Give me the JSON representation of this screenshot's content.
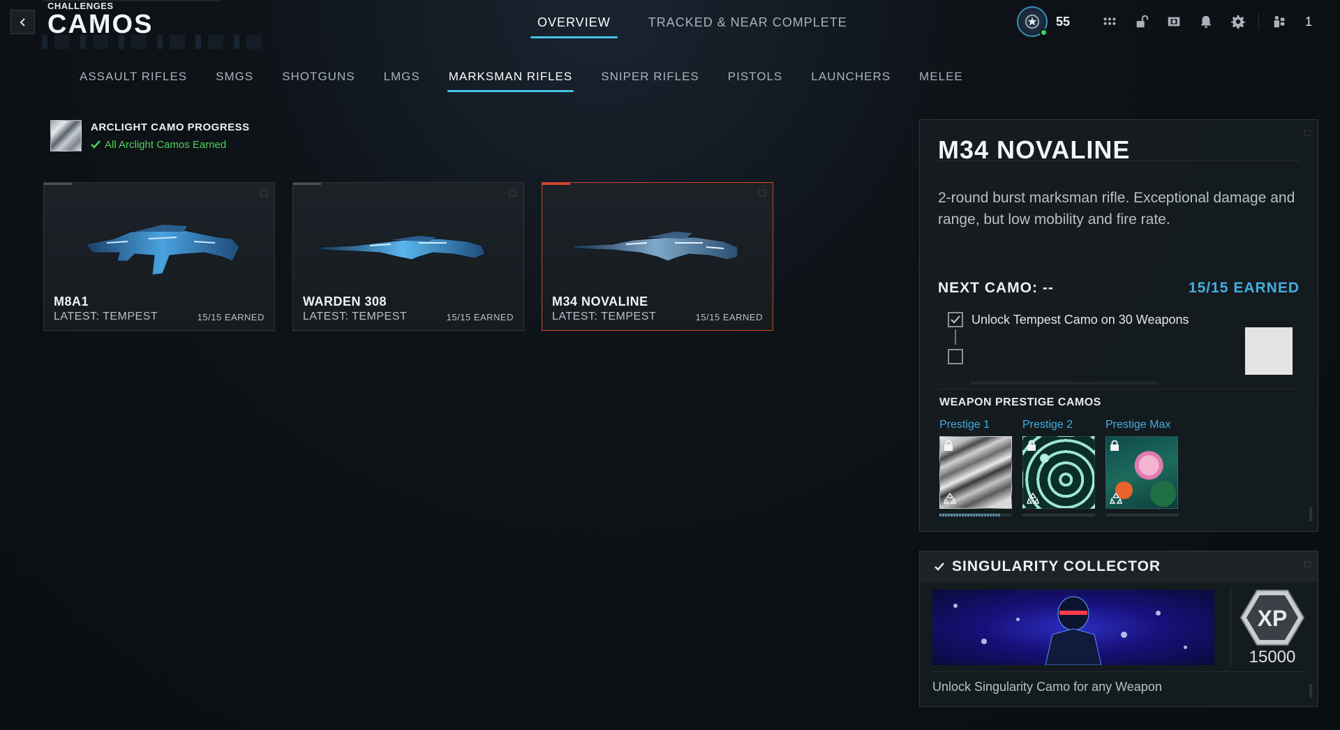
{
  "header": {
    "breadcrumb": "CHALLENGES",
    "title": "CAMOS",
    "tabs": [
      {
        "label": "OVERVIEW",
        "active": true
      },
      {
        "label": "TRACKED & NEAR COMPLETE",
        "active": false
      }
    ],
    "player_level": "55",
    "party_count": "1",
    "icons": [
      "grid-menu-icon",
      "lock-open-icon",
      "camera-icon",
      "bell-icon",
      "gear-icon",
      "party-icon"
    ]
  },
  "categories": [
    {
      "label": "ASSAULT RIFLES",
      "active": false
    },
    {
      "label": "SMGS",
      "active": false
    },
    {
      "label": "SHOTGUNS",
      "active": false
    },
    {
      "label": "LMGS",
      "active": false
    },
    {
      "label": "MARKSMAN RIFLES",
      "active": true
    },
    {
      "label": "SNIPER RIFLES",
      "active": false
    },
    {
      "label": "PISTOLS",
      "active": false
    },
    {
      "label": "LAUNCHERS",
      "active": false
    },
    {
      "label": "MELEE",
      "active": false
    }
  ],
  "arclight": {
    "title": "ARCLIGHT CAMO PROGRESS",
    "status": "All Arclight Camos Earned"
  },
  "weapons": [
    {
      "name": "M8A1",
      "latest": "LATEST: TEMPEST",
      "earned": "15/15 EARNED",
      "selected": false
    },
    {
      "name": "WARDEN 308",
      "latest": "LATEST: TEMPEST",
      "earned": "15/15 EARNED",
      "selected": false
    },
    {
      "name": "M34 NOVALINE",
      "latest": "LATEST: TEMPEST",
      "earned": "15/15 EARNED",
      "selected": true
    }
  ],
  "detail": {
    "title": "M34 NOVALINE",
    "description": "2-round burst marksman rifle. Exceptional damage and range, but low mobility and fire rate.",
    "next_camo": "NEXT CAMO: --",
    "earned": "15/15 EARNED",
    "challenge": "Unlock Tempest Camo on 30 Weapons",
    "prestige_title": "WEAPON PRESTIGE CAMOS",
    "prestige": [
      {
        "label": "Prestige 1",
        "progress": 0.85
      },
      {
        "label": "Prestige 2",
        "progress": 0
      },
      {
        "label": "Prestige Max",
        "progress": 0
      }
    ]
  },
  "singularity": {
    "title": "SINGULARITY COLLECTOR",
    "xp_label": "XP",
    "xp_value": "15000",
    "description": "Unlock Singularity Camo for any Weapon"
  },
  "colors": {
    "accent": "#45c4ea",
    "earned_blue": "#45aee0",
    "success_green": "#4fd25a",
    "selected_red": "#d3452d"
  }
}
